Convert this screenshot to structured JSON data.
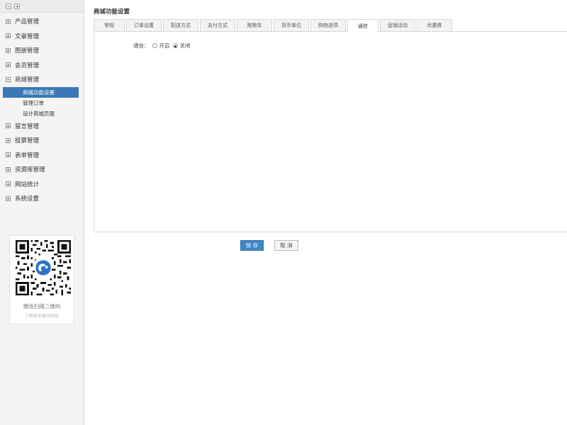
{
  "sidebar": {
    "toolbar": {
      "collapse_icon": "collapse-all-icon",
      "expand_icon": "expand-all-icon"
    },
    "groups": [
      {
        "label": "产品管理",
        "expanded": false
      },
      {
        "label": "文章管理",
        "expanded": false
      },
      {
        "label": "图册管理",
        "expanded": false
      },
      {
        "label": "会员管理",
        "expanded": false
      },
      {
        "label": "商城管理",
        "expanded": true,
        "children": [
          {
            "label": "商城功能设置",
            "active": true
          },
          {
            "label": "管理订单",
            "active": false
          },
          {
            "label": "设计商城页面",
            "active": false
          }
        ]
      },
      {
        "label": "留言管理",
        "expanded": false
      },
      {
        "label": "投票管理",
        "expanded": false
      },
      {
        "label": "表单管理",
        "expanded": false
      },
      {
        "label": "资源库管理",
        "expanded": false
      },
      {
        "label": "网站统计",
        "expanded": false
      },
      {
        "label": "系统设置",
        "expanded": false
      }
    ],
    "qr": {
      "caption": "微信扫描二维码",
      "subcaption": "了解更多建站动态"
    }
  },
  "main": {
    "title": "商城功能设置",
    "tabs": [
      {
        "label": "常规",
        "active": false
      },
      {
        "label": "订单设置",
        "active": false
      },
      {
        "label": "配送方式",
        "active": false
      },
      {
        "label": "支付方式",
        "active": false
      },
      {
        "label": "购物车",
        "active": false
      },
      {
        "label": "货币单位",
        "active": false
      },
      {
        "label": "购物选项",
        "active": false
      },
      {
        "label": "通信",
        "active": true
      },
      {
        "label": "促销活动",
        "active": false
      },
      {
        "label": "优惠券",
        "active": false
      }
    ],
    "field": {
      "label": "通信：",
      "options": [
        {
          "label": "开启",
          "checked": false
        },
        {
          "label": "关闭",
          "checked": true
        }
      ]
    },
    "save_label": "保 存",
    "cancel_label": "取 消"
  },
  "colors": {
    "accent": "#3a78b7",
    "save_button": "#3f86c8"
  }
}
